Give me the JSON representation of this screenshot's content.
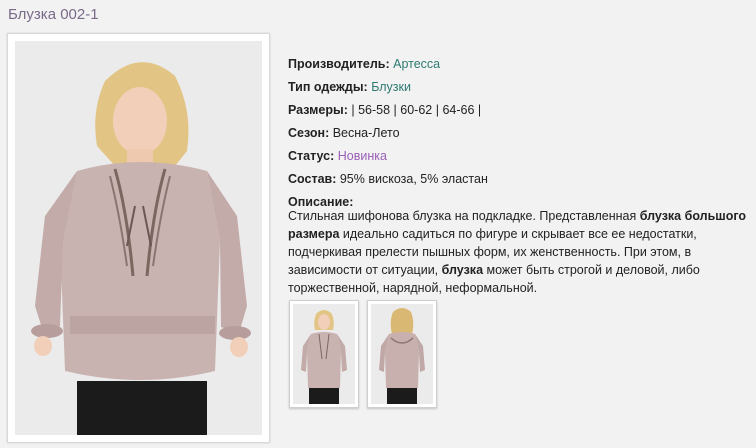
{
  "product": {
    "title": "Блузка 002-1"
  },
  "specs": {
    "manufacturer_label": "Производитель:",
    "manufacturer_value": "Артесса",
    "type_label": "Тип одежды:",
    "type_value": "Блузки",
    "sizes_label": "Размеры:",
    "sizes_prefix": " | ",
    "sizes": [
      "56-58",
      "60-62",
      "64-66"
    ],
    "sizes_sep": " | ",
    "sizes_suffix": " |",
    "season_label": "Сезон:",
    "season_value": "Весна-Лето",
    "status_label": "Статус:",
    "status_value": "Новинка",
    "composition_label": "Состав:",
    "composition_value": "95% вискоза, 5% эластан",
    "description_label": "Описание:"
  },
  "description": {
    "p1": "Стильная шифонова блузка на подкладке. Представленная ",
    "b1": "блузка большого размера",
    "p2": " идеально садиться по фигуре и скрывает все ее недостатки, подчеркивая прелести пышных форм, их женственность. При этом, в зависимости от ситуации, ",
    "b2": "блузка",
    "p3": " может быть строгой и деловой, либо торжественной, нарядной, неформальной."
  },
  "colors": {
    "title": "#7a6a8a",
    "teal_link": "#2f7a73",
    "purple_link": "#9a5fb5",
    "blouse": "#c9b3b1",
    "skirt": "#1b1b1b"
  }
}
